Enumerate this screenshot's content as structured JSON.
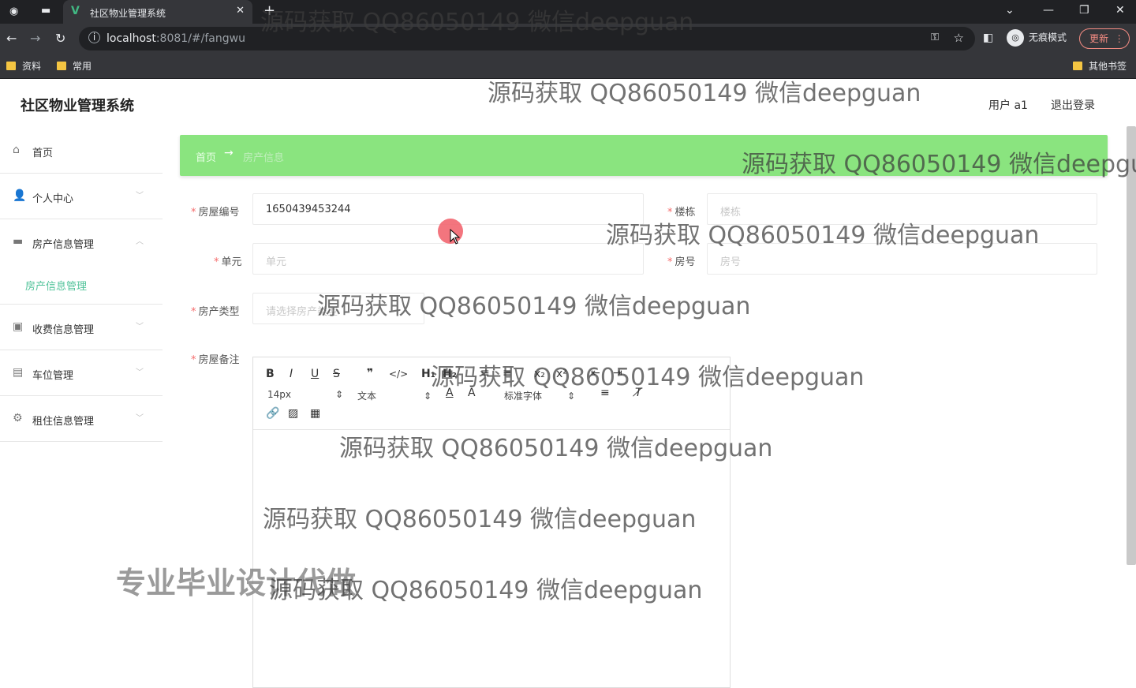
{
  "browser": {
    "tab_title": "社区物业管理系统",
    "url_host": "localhost",
    "url_rest": ":8081/#/fangwu",
    "incognito_label": "无痕模式",
    "update_label": "更新",
    "bookmarks": [
      "资料",
      "常用"
    ],
    "other_bookmarks": "其他书签"
  },
  "header": {
    "app_title": "社区物业管理系统",
    "user_label": "用户 a1",
    "logout_label": "退出登录"
  },
  "sidebar": {
    "items": [
      {
        "label": "首页",
        "icon": "home-icon"
      },
      {
        "label": "个人中心",
        "icon": "user-icon"
      },
      {
        "label": "房产信息管理",
        "icon": "monitor-icon"
      },
      {
        "label": "房产信息管理",
        "sub": true
      },
      {
        "label": "收费信息管理",
        "icon": "briefcase-icon"
      },
      {
        "label": "车位管理",
        "icon": "document-icon"
      },
      {
        "label": "租住信息管理",
        "icon": "settings-icon"
      }
    ]
  },
  "breadcrumb": {
    "home": "首页",
    "arrow": "→",
    "current": "房产信息"
  },
  "form": {
    "house_no": {
      "label": "房屋编号",
      "value": "1650439453244"
    },
    "building": {
      "label": "楼栋",
      "placeholder": "楼栋"
    },
    "unit": {
      "label": "单元",
      "placeholder": "单元"
    },
    "room_no": {
      "label": "房号",
      "placeholder": "房号"
    },
    "house_type": {
      "label": "房产类型",
      "placeholder": "请选择房产类型"
    },
    "remark": {
      "label": "房屋备注"
    }
  },
  "editor": {
    "font_size": "14px",
    "paragraph": "文本",
    "font_family": "标准字体"
  },
  "watermarks": {
    "text": "源码获取 QQ86050149 微信deepguan",
    "partial": "源码获取 QQ86050149 微信deepgu",
    "promo": "专业毕业设计代做"
  }
}
